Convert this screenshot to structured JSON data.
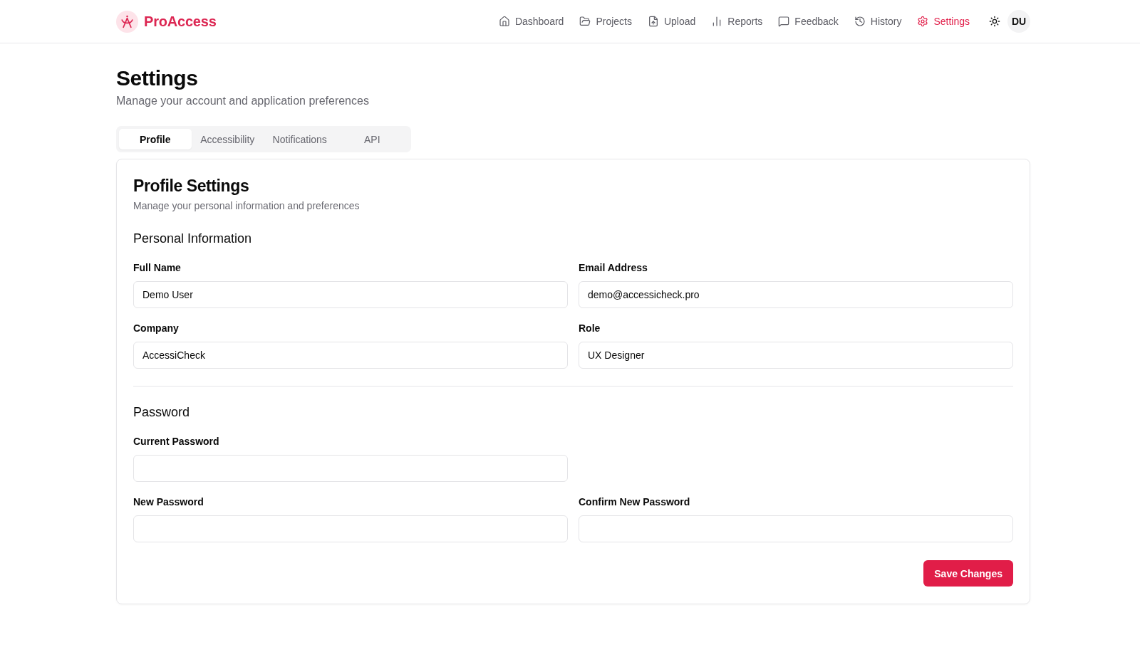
{
  "brand": {
    "name": "ProAccess"
  },
  "nav": [
    {
      "label": "Dashboard",
      "selected": false
    },
    {
      "label": "Projects",
      "selected": false
    },
    {
      "label": "Upload",
      "selected": false
    },
    {
      "label": "Reports",
      "selected": false
    },
    {
      "label": "Feedback",
      "selected": false
    },
    {
      "label": "History",
      "selected": false
    },
    {
      "label": "Settings",
      "selected": true
    }
  ],
  "user": {
    "initials": "DU"
  },
  "page": {
    "title": "Settings",
    "subtitle": "Manage your account and application preferences"
  },
  "tabs": [
    {
      "label": "Profile",
      "selected": true
    },
    {
      "label": "Accessibility",
      "selected": false
    },
    {
      "label": "Notifications",
      "selected": false
    },
    {
      "label": "API",
      "selected": false
    }
  ],
  "card": {
    "title": "Profile Settings",
    "subtitle": "Manage your personal information and preferences",
    "sections": [
      {
        "title": "Personal Information",
        "rows": [
          [
            {
              "label": "Full Name",
              "value": "Demo User"
            },
            {
              "label": "Email Address",
              "value": "demo@accessicheck.pro"
            }
          ],
          [
            {
              "label": "Company",
              "value": "AccessiCheck"
            },
            {
              "label": "Role",
              "value": "UX Designer"
            }
          ]
        ]
      },
      {
        "title": "Password",
        "rows": [
          [
            {
              "label": "Current Password"
            }
          ],
          [
            {
              "label": "New Password"
            },
            {
              "label": "Confirm New Password"
            }
          ]
        ]
      }
    ],
    "save_button": "Save Changes"
  }
}
